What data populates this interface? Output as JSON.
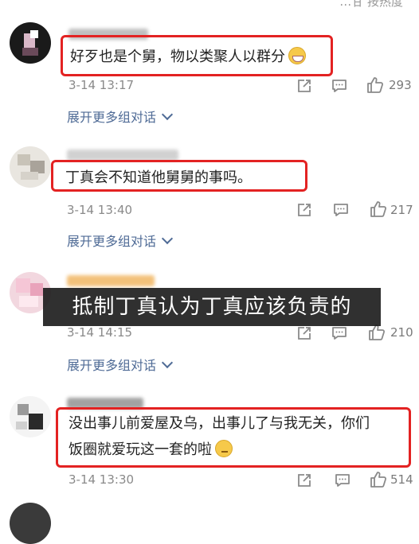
{
  "header": {
    "sort_label": "…甘 按热度"
  },
  "subtitle": "抵制丁真认为丁真应该负责的",
  "comments": [
    {
      "text": "好歹也是个舅，物以类聚人以群分",
      "emoji": "grin-emoji",
      "time": "3-14 13:17",
      "likes": "293",
      "expand": "展开更多组对话"
    },
    {
      "text": "丁真会不知道他舅舅的事吗。",
      "time": "3-14 13:40",
      "likes": "217",
      "expand": "展开更多组对话"
    },
    {
      "time": "3-14 14:15",
      "likes": "210",
      "expand": "展开更多组对话"
    },
    {
      "text_line1": "没出事儿前爱屋及乌，出事儿了与我无关，你们",
      "text_line2": "饭圈就爱玩这一套的啦",
      "emoji": "thinking-emoji",
      "time": "3-14 13:30",
      "likes": "514"
    }
  ],
  "icons": {
    "share": "share-icon",
    "reply": "comment-icon",
    "like": "thumbs-up-icon",
    "expand": "chevron-down-icon"
  },
  "colors": {
    "highlight": "#e32222",
    "link": "#4f6b96",
    "meta": "#8a8a8a",
    "subtitle_bg": "#191919"
  }
}
